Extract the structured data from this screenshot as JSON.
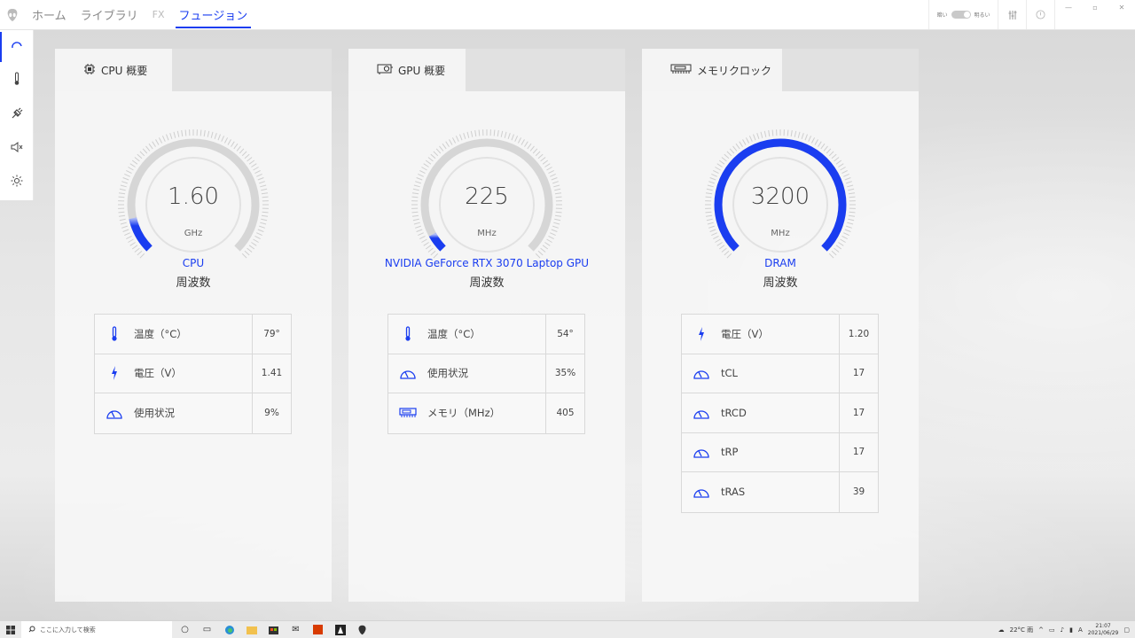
{
  "nav": {
    "tabs": [
      {
        "label": "ホーム"
      },
      {
        "label": "ライブラリ"
      },
      {
        "label": "FX"
      },
      {
        "label": "フュージョン"
      }
    ],
    "brightness": {
      "dark": "暗い",
      "bright": "明るい"
    }
  },
  "accent": "#1a3df0",
  "panels": [
    {
      "title": "CPU 概要",
      "value": "1.60",
      "unit": "GHz",
      "name": "CPU",
      "sub": "周波数",
      "fill": 0.12,
      "rows": [
        {
          "icon": "thermometer-icon",
          "label": "温度（°C）",
          "value": "79°"
        },
        {
          "icon": "bolt-icon",
          "label": "電圧（V）",
          "value": "1.41"
        },
        {
          "icon": "gauge-icon",
          "label": "使用状況",
          "value": "9%"
        }
      ]
    },
    {
      "title": "GPU 概要",
      "value": "225",
      "unit": "MHz",
      "name": "NVIDIA GeForce RTX 3070 Laptop GPU",
      "sub": "周波数",
      "fill": 0.06,
      "rows": [
        {
          "icon": "thermometer-icon",
          "label": "温度（°C）",
          "value": "54°"
        },
        {
          "icon": "gauge-icon",
          "label": "使用状況",
          "value": "35%"
        },
        {
          "icon": "memory-icon",
          "label": "メモリ（MHz）",
          "value": "405"
        }
      ]
    },
    {
      "title": "メモリクロック",
      "value": "3200",
      "unit": "MHz",
      "name": "DRAM",
      "sub": "周波数",
      "fill": 1.0,
      "rows": [
        {
          "icon": "bolt-icon",
          "label": "電圧（V）",
          "value": "1.20"
        },
        {
          "icon": "gauge-icon",
          "label": "tCL",
          "value": "17"
        },
        {
          "icon": "gauge-icon",
          "label": "tRCD",
          "value": "17"
        },
        {
          "icon": "gauge-icon",
          "label": "tRP",
          "value": "17"
        },
        {
          "icon": "gauge-icon",
          "label": "tRAS",
          "value": "39"
        }
      ]
    }
  ],
  "taskbar": {
    "search_placeholder": "ここに入力して検索",
    "temp": "22°C 雨",
    "ime": "A",
    "time": "21:07",
    "date": "2021/06/29"
  }
}
